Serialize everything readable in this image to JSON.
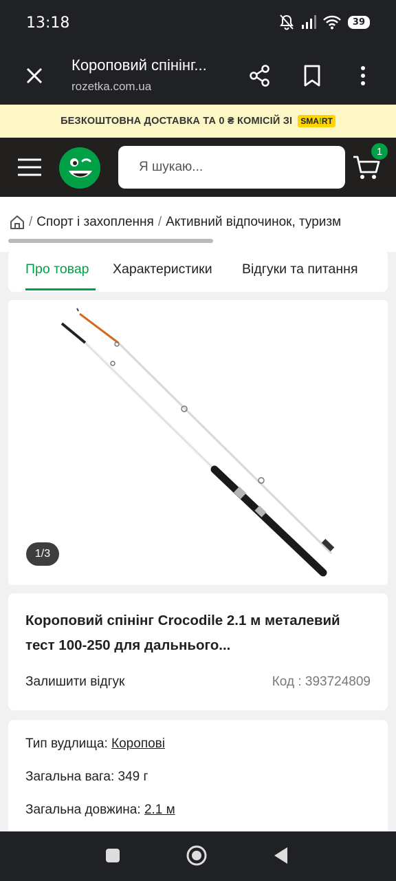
{
  "status": {
    "time": "13:18",
    "battery": "39"
  },
  "browser": {
    "title": "Коропoвий спінінг...",
    "url": "rozetka.com.ua"
  },
  "promo": {
    "text": "БЕЗКОШТОВНА ДОСТАВКА ТА 0 ₴ КОМІСІЙ ЗІ",
    "badge_a": "SMA",
    "badge_b": "!",
    "badge_c": "RT"
  },
  "header": {
    "search_placeholder": "Я шукаю...",
    "cart_count": "1"
  },
  "breadcrumb": {
    "sep": "/",
    "items": [
      "Спорт і захоплення",
      "Активний відпочинок, туризм"
    ]
  },
  "tabs": [
    "Про товар",
    "Характеристики",
    "Відгуки та питання"
  ],
  "gallery": {
    "counter": "1/3"
  },
  "product": {
    "title": "Коропoвий спінінг Crocodile 2.1 м металевий тест 100-250 для дальнього...",
    "review_link": "Залишити відгук",
    "code_label": "Код :",
    "code_value": "393724809"
  },
  "specs": [
    {
      "label": "Тип вудлища:",
      "value": "Коропові"
    },
    {
      "label": "Загальна вага:",
      "value": "349 г"
    },
    {
      "label": "Загальна довжина:",
      "value": "2.1 м"
    }
  ],
  "colors": {
    "accent": "#00a046",
    "dark": "#221f1f",
    "promo_bg": "#fdf6c5"
  }
}
